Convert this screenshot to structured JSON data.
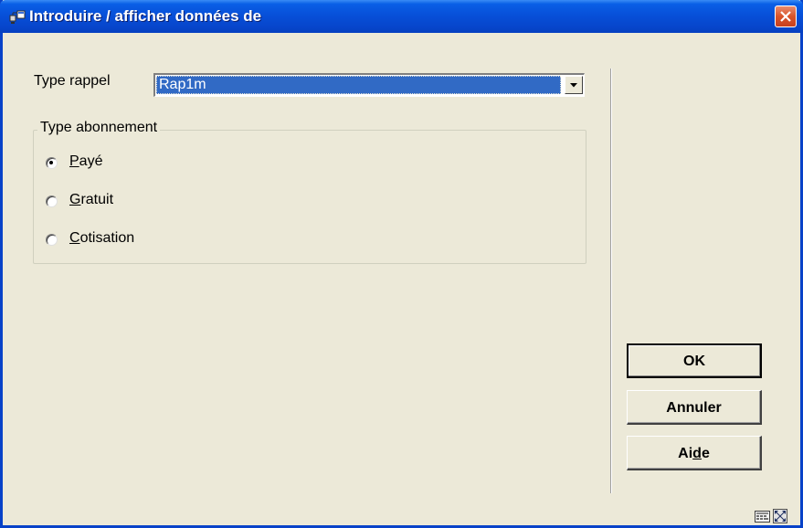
{
  "window": {
    "title": "Introduire / afficher données de"
  },
  "form": {
    "type_rappel_label": "Type rappel",
    "type_rappel_value": "Rap1m",
    "group_label": "Type abonnement",
    "options": [
      {
        "pre": "",
        "key": "P",
        "post": "ayé",
        "selected": true
      },
      {
        "pre": "",
        "key": "G",
        "post": "ratuit",
        "selected": false
      },
      {
        "pre": "",
        "key": "C",
        "post": "otisation",
        "selected": false
      }
    ]
  },
  "buttons": {
    "ok": {
      "pre": "OK",
      "key": "",
      "post": ""
    },
    "annuler": {
      "pre": "Annuler",
      "key": "",
      "post": ""
    },
    "aide": {
      "pre": "Ai",
      "key": "d",
      "post": "e"
    }
  },
  "colors": {
    "titlebar": "#0750D9",
    "selection": "#316AC5",
    "face": "#ECE9D8",
    "close": "#D9542A"
  },
  "icons": [
    "app-icon",
    "close-icon",
    "dropdown-arrow-icon",
    "keyboard-icon",
    "resize-icon"
  ]
}
